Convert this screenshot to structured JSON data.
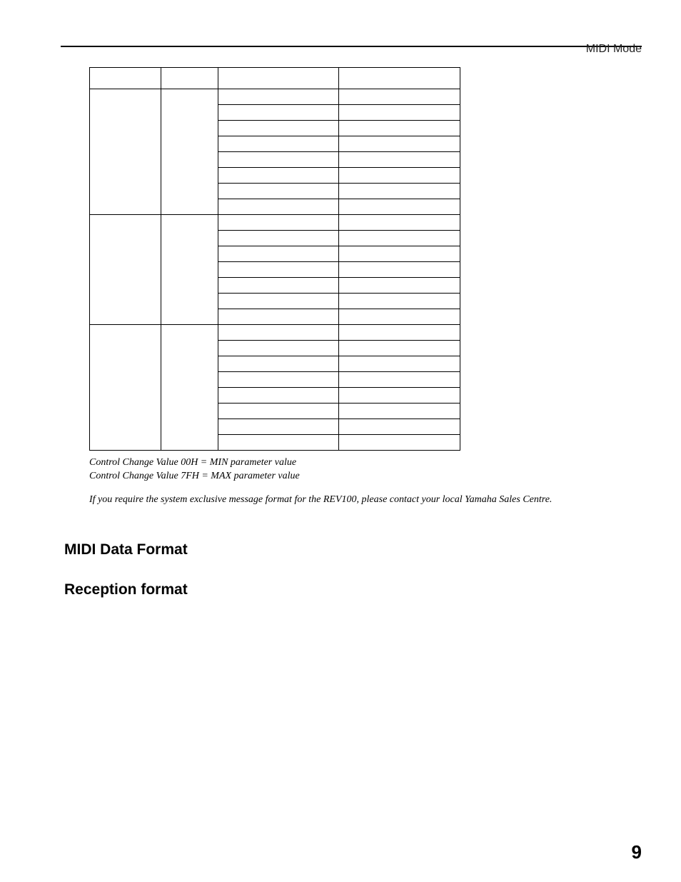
{
  "header": {
    "section": "MIDI Mode"
  },
  "page_number": "9",
  "table": {
    "columnCount": 4,
    "headers": [
      "",
      "",
      "",
      ""
    ],
    "groups": [
      {
        "type": "",
        "sub": "",
        "rowCount": 8
      },
      {
        "type": "",
        "sub": "",
        "rowCount": 7
      },
      {
        "type": "",
        "sub": "",
        "rowCount": 8
      }
    ]
  },
  "notes": {
    "line1": "Control Change Value 00H = MIN parameter value",
    "line2": "Control Change Value 7FH = MAX parameter value",
    "extra": "If you require the system exclusive message format for the REV100, please contact your local Yamaha Sales Centre."
  },
  "headings": {
    "midi_data_format": "MIDI Data Format",
    "reception_format": "Reception format"
  }
}
